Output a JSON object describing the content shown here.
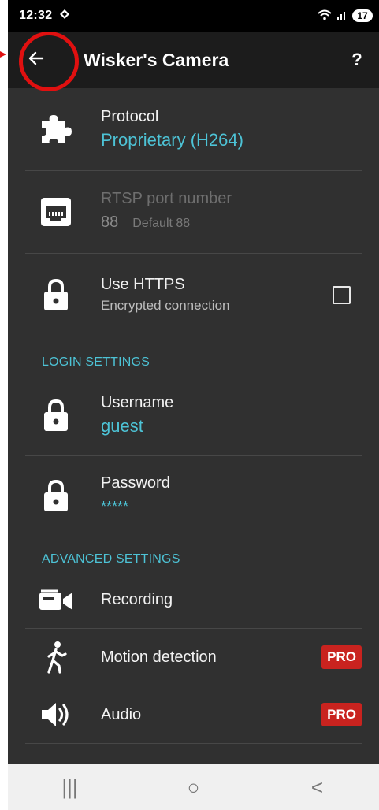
{
  "status_bar": {
    "time": "12:32",
    "battery_level": "17"
  },
  "toolbar": {
    "title": "Wisker's Camera",
    "help_label": "?"
  },
  "settings": [
    {
      "label": "Protocol",
      "value": "Proprietary (H264)"
    },
    {
      "label": "RTSP port number",
      "value": "88",
      "hint": "Default 88"
    },
    {
      "label": "Use HTTPS",
      "sub": "Encrypted connection",
      "checked": false
    }
  ],
  "sections": {
    "login": "LOGIN SETTINGS",
    "advanced": "ADVANCED SETTINGS"
  },
  "login": [
    {
      "label": "Username",
      "value": "guest"
    },
    {
      "label": "Password",
      "value": "*****"
    }
  ],
  "advanced": [
    {
      "label": "Recording"
    },
    {
      "label": "Motion detection",
      "badge": "PRO"
    },
    {
      "label": "Audio",
      "badge": "PRO"
    }
  ],
  "navbar": {
    "recents_glyph": "|||",
    "home_glyph": "○",
    "back_glyph": "<"
  },
  "colors": {
    "accent": "#4dc3d6",
    "pro_badge": "#c9231f",
    "background": "#303030",
    "toolbar": "#1c1c1c"
  }
}
